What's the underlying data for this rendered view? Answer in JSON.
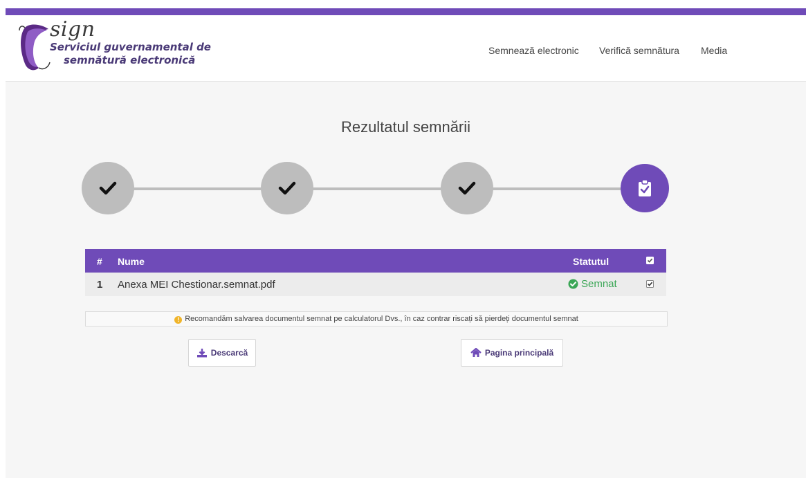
{
  "brand": {
    "name": "sign",
    "line1": "Serviciul guvernamental de",
    "line2": "semnătură electronică"
  },
  "nav": {
    "items": [
      {
        "label": "Semnează electronic"
      },
      {
        "label": "Verifică semnătura"
      },
      {
        "label": "Media"
      }
    ]
  },
  "page": {
    "title": "Rezultatul semnării"
  },
  "stepper": {
    "steps": [
      {
        "state": "done",
        "icon": "check-icon"
      },
      {
        "state": "done",
        "icon": "check-icon"
      },
      {
        "state": "done",
        "icon": "check-icon"
      },
      {
        "state": "active",
        "icon": "clipboard-check-icon"
      }
    ]
  },
  "table": {
    "headers": {
      "index": "#",
      "name": "Nume",
      "status": "Statutul"
    },
    "rows": [
      {
        "index": "1",
        "name": "Anexa MEI Chestionar.semnat.pdf",
        "status": "Semnat",
        "checked": true
      }
    ]
  },
  "notice": {
    "text": "Recomandăm salvarea documentul semnat pe calculatorul Dvs., în caz contrar riscați să pierdeți documentul semnat"
  },
  "buttons": {
    "download": "Descarcă",
    "home": "Pagina principală"
  },
  "colors": {
    "accent": "#6f4bb8",
    "success": "#3aa655",
    "step_done": "#bdbdbd",
    "warning": "#f0b429"
  }
}
